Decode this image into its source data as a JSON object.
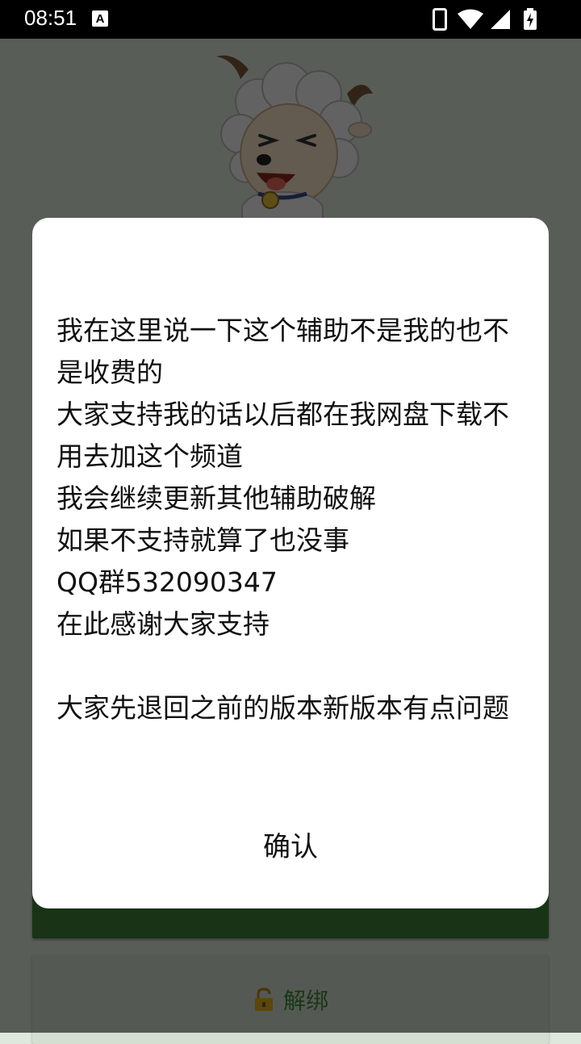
{
  "status_bar": {
    "time": "08:51",
    "notification_badge": "A",
    "icons": [
      "phone-vibrate-icon",
      "wifi-icon",
      "cellular-signal-icon",
      "battery-charging-icon"
    ]
  },
  "dialog": {
    "message": "我在这里说一下这个辅助不是我的也不是收费的\n大家支持我的话以后都在我网盘下载不用去加这个频道\n我会继续更新其他辅助破解\n如果不支持就算了也没事\nQQ群532090347\n在此感谢大家支持\n\n大家先退回之前的版本新版本有点问题",
    "confirm_label": "确认"
  },
  "background": {
    "unbind_label": "解绑",
    "unbind_icon": "lock-open-icon",
    "mascot": "sheep-mascot-image"
  },
  "colors": {
    "scrim": "#000000",
    "accent_green": "#3f7f3a",
    "unbind_text": "#3f8a3a"
  }
}
